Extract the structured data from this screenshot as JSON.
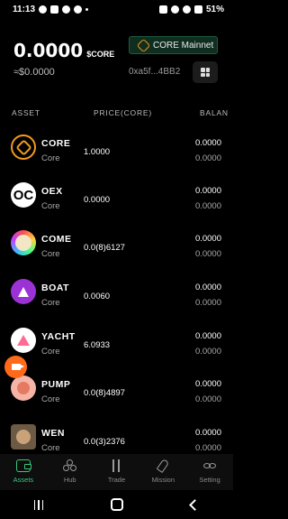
{
  "status_bar": {
    "time": "11:13",
    "battery": "51%",
    "left_icons": [
      "whatsapp-icon",
      "notification-icon",
      "facebook-icon",
      "messenger-icon",
      "dot-icon"
    ],
    "right_icons": [
      "screenshot-icon",
      "mute-icon",
      "wifi-icon",
      "signal-icon",
      "battery-icon"
    ]
  },
  "wallet": {
    "balance": "0.0000",
    "unit": "$CORE",
    "fiat": "≈$0.0000",
    "network": "CORE Mainnet",
    "address": "0xa5f...4BB2",
    "accent": "#39c97a",
    "network_bg": "#0f2e20"
  },
  "table": {
    "headers": {
      "asset": "ASSET",
      "price": "PRICE(CORE)",
      "balance": "BALAN"
    },
    "rows": [
      {
        "symbol": "CORE",
        "name": "Core",
        "price": "1.0000",
        "balance": "0.0000",
        "fiat": "0.0000",
        "icon": "core-token-icon"
      },
      {
        "symbol": "OEX",
        "name": "Core",
        "price": "0.0000",
        "balance": "0.0000",
        "fiat": "0.0000",
        "icon": "oex-token-icon"
      },
      {
        "symbol": "COME",
        "name": "Core",
        "price": "0.0(8)6127",
        "balance": "0.0000",
        "fiat": "0.0000",
        "icon": "come-token-icon"
      },
      {
        "symbol": "BOAT",
        "name": "Core",
        "price": "0.0060",
        "balance": "0.0000",
        "fiat": "0.0000",
        "icon": "boat-token-icon"
      },
      {
        "symbol": "YACHT",
        "name": "Core",
        "price": "6.0933",
        "balance": "0.0000",
        "fiat": "0.0000",
        "icon": "yacht-token-icon"
      },
      {
        "symbol": "PUMP",
        "name": "Core",
        "price": "0.0(8)4897",
        "balance": "0.0000",
        "fiat": "0.0000",
        "icon": "pump-token-icon"
      },
      {
        "symbol": "WEN",
        "name": "Core",
        "price": "0.0(3)2376",
        "balance": "0.0000",
        "fiat": "0.0000",
        "icon": "wen-token-icon"
      }
    ]
  },
  "oex_glyph": "OC",
  "bottom_nav": [
    {
      "label": "Assets",
      "icon": "wallet-icon",
      "active": true
    },
    {
      "label": "Hub",
      "icon": "hub-icon",
      "active": false
    },
    {
      "label": "Trade",
      "icon": "trade-icon",
      "active": false
    },
    {
      "label": "Mission",
      "icon": "rocket-icon",
      "active": false
    },
    {
      "label": "Setting",
      "icon": "infinity-icon",
      "active": false
    }
  ],
  "android_nav": [
    "recents-icon",
    "home-icon",
    "back-icon"
  ]
}
